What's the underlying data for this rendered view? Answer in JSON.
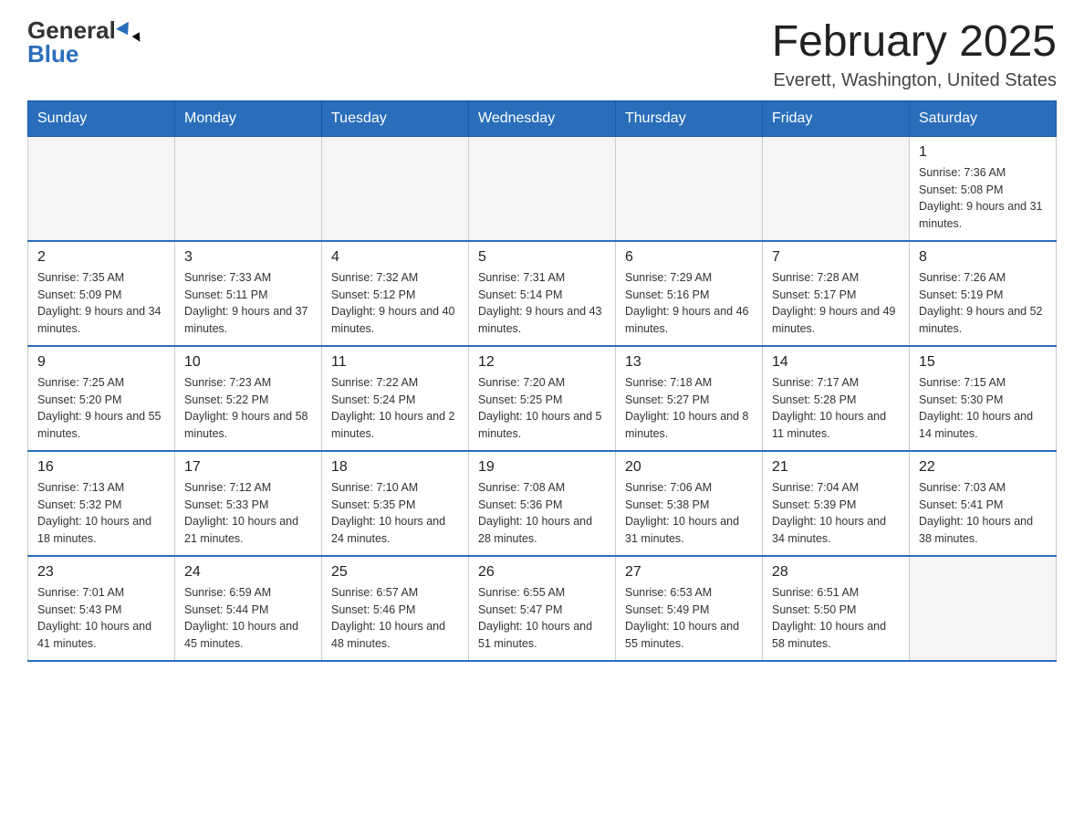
{
  "logo": {
    "general": "General",
    "blue": "Blue"
  },
  "title": "February 2025",
  "location": "Everett, Washington, United States",
  "days_of_week": [
    "Sunday",
    "Monday",
    "Tuesday",
    "Wednesday",
    "Thursday",
    "Friday",
    "Saturday"
  ],
  "weeks": [
    [
      {
        "day": "",
        "info": "",
        "empty": true
      },
      {
        "day": "",
        "info": "",
        "empty": true
      },
      {
        "day": "",
        "info": "",
        "empty": true
      },
      {
        "day": "",
        "info": "",
        "empty": true
      },
      {
        "day": "",
        "info": "",
        "empty": true
      },
      {
        "day": "",
        "info": "",
        "empty": true
      },
      {
        "day": "1",
        "info": "Sunrise: 7:36 AM\nSunset: 5:08 PM\nDaylight: 9 hours and 31 minutes.",
        "empty": false
      }
    ],
    [
      {
        "day": "2",
        "info": "Sunrise: 7:35 AM\nSunset: 5:09 PM\nDaylight: 9 hours and 34 minutes.",
        "empty": false
      },
      {
        "day": "3",
        "info": "Sunrise: 7:33 AM\nSunset: 5:11 PM\nDaylight: 9 hours and 37 minutes.",
        "empty": false
      },
      {
        "day": "4",
        "info": "Sunrise: 7:32 AM\nSunset: 5:12 PM\nDaylight: 9 hours and 40 minutes.",
        "empty": false
      },
      {
        "day": "5",
        "info": "Sunrise: 7:31 AM\nSunset: 5:14 PM\nDaylight: 9 hours and 43 minutes.",
        "empty": false
      },
      {
        "day": "6",
        "info": "Sunrise: 7:29 AM\nSunset: 5:16 PM\nDaylight: 9 hours and 46 minutes.",
        "empty": false
      },
      {
        "day": "7",
        "info": "Sunrise: 7:28 AM\nSunset: 5:17 PM\nDaylight: 9 hours and 49 minutes.",
        "empty": false
      },
      {
        "day": "8",
        "info": "Sunrise: 7:26 AM\nSunset: 5:19 PM\nDaylight: 9 hours and 52 minutes.",
        "empty": false
      }
    ],
    [
      {
        "day": "9",
        "info": "Sunrise: 7:25 AM\nSunset: 5:20 PM\nDaylight: 9 hours and 55 minutes.",
        "empty": false
      },
      {
        "day": "10",
        "info": "Sunrise: 7:23 AM\nSunset: 5:22 PM\nDaylight: 9 hours and 58 minutes.",
        "empty": false
      },
      {
        "day": "11",
        "info": "Sunrise: 7:22 AM\nSunset: 5:24 PM\nDaylight: 10 hours and 2 minutes.",
        "empty": false
      },
      {
        "day": "12",
        "info": "Sunrise: 7:20 AM\nSunset: 5:25 PM\nDaylight: 10 hours and 5 minutes.",
        "empty": false
      },
      {
        "day": "13",
        "info": "Sunrise: 7:18 AM\nSunset: 5:27 PM\nDaylight: 10 hours and 8 minutes.",
        "empty": false
      },
      {
        "day": "14",
        "info": "Sunrise: 7:17 AM\nSunset: 5:28 PM\nDaylight: 10 hours and 11 minutes.",
        "empty": false
      },
      {
        "day": "15",
        "info": "Sunrise: 7:15 AM\nSunset: 5:30 PM\nDaylight: 10 hours and 14 minutes.",
        "empty": false
      }
    ],
    [
      {
        "day": "16",
        "info": "Sunrise: 7:13 AM\nSunset: 5:32 PM\nDaylight: 10 hours and 18 minutes.",
        "empty": false
      },
      {
        "day": "17",
        "info": "Sunrise: 7:12 AM\nSunset: 5:33 PM\nDaylight: 10 hours and 21 minutes.",
        "empty": false
      },
      {
        "day": "18",
        "info": "Sunrise: 7:10 AM\nSunset: 5:35 PM\nDaylight: 10 hours and 24 minutes.",
        "empty": false
      },
      {
        "day": "19",
        "info": "Sunrise: 7:08 AM\nSunset: 5:36 PM\nDaylight: 10 hours and 28 minutes.",
        "empty": false
      },
      {
        "day": "20",
        "info": "Sunrise: 7:06 AM\nSunset: 5:38 PM\nDaylight: 10 hours and 31 minutes.",
        "empty": false
      },
      {
        "day": "21",
        "info": "Sunrise: 7:04 AM\nSunset: 5:39 PM\nDaylight: 10 hours and 34 minutes.",
        "empty": false
      },
      {
        "day": "22",
        "info": "Sunrise: 7:03 AM\nSunset: 5:41 PM\nDaylight: 10 hours and 38 minutes.",
        "empty": false
      }
    ],
    [
      {
        "day": "23",
        "info": "Sunrise: 7:01 AM\nSunset: 5:43 PM\nDaylight: 10 hours and 41 minutes.",
        "empty": false
      },
      {
        "day": "24",
        "info": "Sunrise: 6:59 AM\nSunset: 5:44 PM\nDaylight: 10 hours and 45 minutes.",
        "empty": false
      },
      {
        "day": "25",
        "info": "Sunrise: 6:57 AM\nSunset: 5:46 PM\nDaylight: 10 hours and 48 minutes.",
        "empty": false
      },
      {
        "day": "26",
        "info": "Sunrise: 6:55 AM\nSunset: 5:47 PM\nDaylight: 10 hours and 51 minutes.",
        "empty": false
      },
      {
        "day": "27",
        "info": "Sunrise: 6:53 AM\nSunset: 5:49 PM\nDaylight: 10 hours and 55 minutes.",
        "empty": false
      },
      {
        "day": "28",
        "info": "Sunrise: 6:51 AM\nSunset: 5:50 PM\nDaylight: 10 hours and 58 minutes.",
        "empty": false
      },
      {
        "day": "",
        "info": "",
        "empty": true
      }
    ]
  ]
}
